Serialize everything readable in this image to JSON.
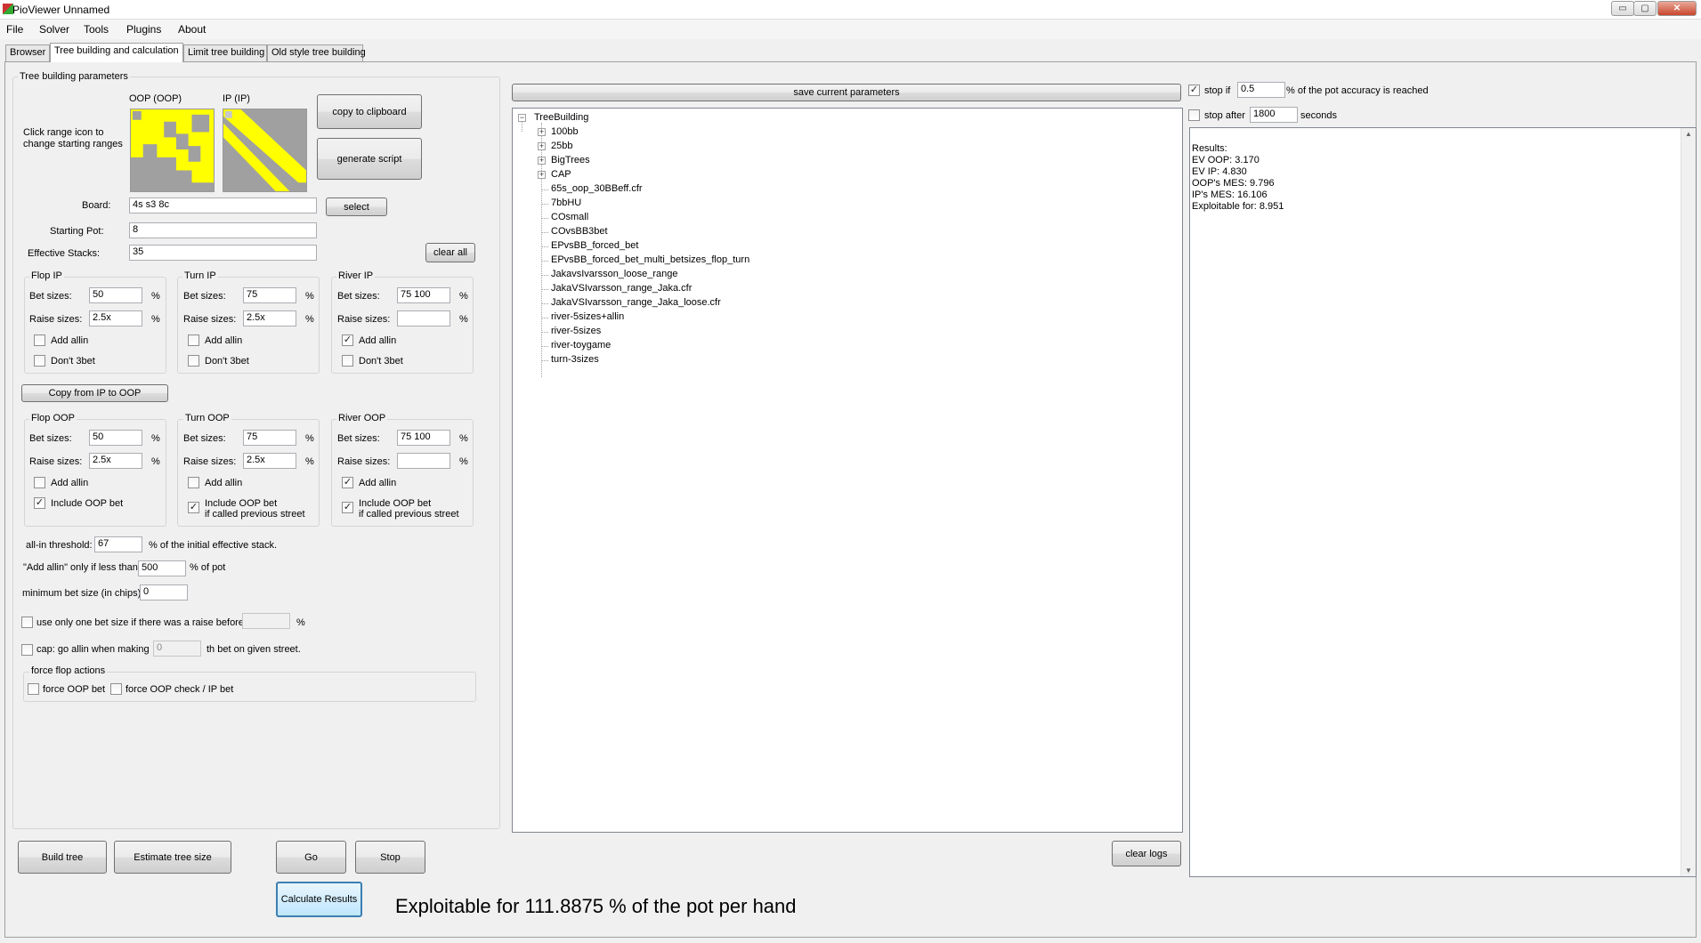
{
  "window": {
    "title": "PioViewer Unnamed",
    "min": "▭",
    "max": "▢",
    "close": "✕"
  },
  "menu": [
    "File",
    "Solver",
    "Tools",
    "Plugins",
    "About"
  ],
  "tabs": [
    "Browser",
    "Tree building and calculation",
    "Limit tree building",
    "Old style tree building"
  ],
  "params": {
    "group_title": "Tree building parameters",
    "oop_label": "OOP (OOP)",
    "ip_label": "IP (IP)",
    "range_hint": "Click range icon to change starting ranges",
    "copy_clipboard": "copy to clipboard",
    "generate_script": "generate script",
    "board_label": "Board:",
    "board_value": "4s s3 8c",
    "select": "select",
    "starting_pot_label": "Starting Pot:",
    "starting_pot_value": "8",
    "effective_stacks_label": "Effective Stacks:",
    "effective_stacks_value": "35",
    "clear_all": "clear all",
    "copy_ip_to_oop": "Copy from IP to OOP"
  },
  "labels": {
    "bet_sizes": "Bet sizes:",
    "raise_sizes": "Raise sizes:",
    "pct": "%",
    "add_allin": "Add allin",
    "dont_3bet": "Don't 3bet",
    "include_oop_bet": "Include OOP bet",
    "include_oop_bet_prev": "Include OOP bet",
    "if_called": "if called previous street"
  },
  "ip_groups": [
    {
      "title": "Flop IP",
      "bet": "50",
      "raise": "2.5x",
      "allin": false,
      "dont3bet": false
    },
    {
      "title": "Turn IP",
      "bet": "75",
      "raise": "2.5x",
      "allin": false,
      "dont3bet": false
    },
    {
      "title": "River IP",
      "bet": "75 100",
      "raise": "",
      "allin": true,
      "dont3bet": false
    }
  ],
  "oop_groups": [
    {
      "title": "Flop OOP",
      "bet": "50",
      "raise": "2.5x",
      "allin": false,
      "include": true
    },
    {
      "title": "Turn OOP",
      "bet": "75",
      "raise": "2.5x",
      "allin": false,
      "include": true
    },
    {
      "title": "River OOP",
      "bet": "75 100",
      "raise": "",
      "allin": true,
      "include": true
    }
  ],
  "extras": {
    "allin_threshold_label": "all-in threshold:",
    "allin_threshold_value": "67",
    "allin_threshold_suffix": "% of the initial effective stack.",
    "add_allin_label": "\"Add allin\" only if less than",
    "add_allin_value": "500",
    "add_allin_suffix": "% of pot",
    "min_bet_label": "minimum bet size (in chips):",
    "min_bet_value": "0",
    "one_bet_label": "use only one bet size if there was a raise before",
    "one_bet_value": "",
    "one_bet_suffix": "%",
    "cap_label": "cap: go allin when making",
    "cap_value": "0",
    "cap_suffix": "th bet on given street.",
    "force_title": "force flop actions",
    "force_oop_bet": "force OOP bet",
    "force_check": "force OOP check / IP bet"
  },
  "bottom": {
    "build_tree": "Build tree",
    "estimate": "Estimate tree size",
    "go": "Go",
    "stop": "Stop",
    "calculate": "Calculate Results",
    "exploitable": "Exploitable for 111.8875 % of the pot per hand"
  },
  "center": {
    "save_params": "save current parameters",
    "clear_logs": "clear logs",
    "tree_root": "TreeBuilding",
    "folders": [
      "100bb",
      "25bb",
      "BigTrees",
      "CAP"
    ],
    "files": [
      "65s_oop_30BBeff.cfr",
      "7bbHU",
      "COsmall",
      "COvsBB3bet",
      "EPvsBB_forced_bet",
      "EPvsBB_forced_bet_multi_betsizes_flop_turn",
      "JakavsIvarsson_loose_range",
      "JakaVSIvarsson_range_Jaka.cfr",
      "JakaVSIvarsson_range_Jaka_loose.cfr",
      "river-5sizes+allin",
      "river-5sizes",
      "river-toygame",
      "turn-3sizes"
    ]
  },
  "right": {
    "stop_if_label": "stop if",
    "stop_if_value": "0.5",
    "stop_if_suffix": "% of the pot accuracy is reached",
    "stop_after_label": "stop after",
    "stop_after_value": "1800",
    "stop_after_suffix": "seconds",
    "results": [
      "Results:",
      "EV OOP: 3.170",
      "EV IP: 4.830",
      "OOP's MES: 9.796",
      "IP's MES: 16.106",
      "Exploitable for: 8.951"
    ]
  },
  "colors": {
    "range_on": "#ffff00",
    "range_off": "#a0a0a0",
    "panel": "#f0f0f0"
  }
}
